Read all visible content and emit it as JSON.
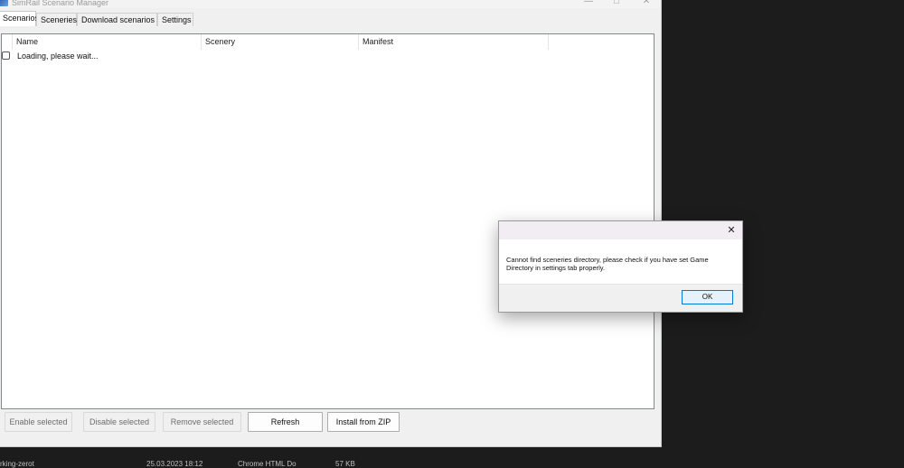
{
  "window": {
    "title": "SimRail Scenario Manager",
    "controls": {
      "minimize": "—",
      "maximize": "□",
      "close": "✕"
    }
  },
  "tabs": [
    {
      "label": "Scenarios",
      "active": true
    },
    {
      "label": "Sceneries",
      "active": false
    },
    {
      "label": "Download scenarios",
      "active": false
    },
    {
      "label": "Settings",
      "active": false
    }
  ],
  "list": {
    "columns": [
      "Name",
      "Scenery",
      "Manifest"
    ],
    "rows": [
      {
        "checked": false,
        "name": "Loading, please wait..."
      }
    ]
  },
  "buttons": {
    "enable_selected": "Enable selected",
    "disable_selected": "Disable selected",
    "remove_selected": "Remove selected",
    "refresh": "Refresh",
    "install_zip": "Install from ZIP"
  },
  "background_row": {
    "name": "rking-zerot",
    "date": "25.03.2023 18:12",
    "type": "Chrome HTML Do",
    "size": "57 KB"
  },
  "dialog": {
    "close": "✕",
    "message": "Cannot find sceneries directory, please check if you have set Game Directory in settings tab properly.",
    "ok": "OK"
  }
}
